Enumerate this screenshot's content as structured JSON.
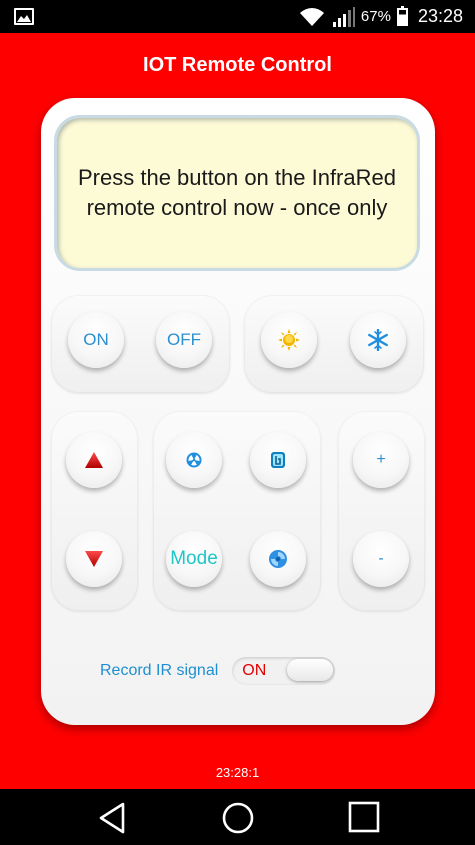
{
  "status_bar": {
    "battery_percent": "67%",
    "time": "23:28",
    "icons": [
      "image-icon",
      "wifi-icon",
      "signal-icon",
      "battery-icon"
    ]
  },
  "app_bar": {
    "title": "IOT Remote Control"
  },
  "display": {
    "message": "Press the button on the InfraRed remote control now - once only"
  },
  "power": {
    "on_label": "ON",
    "off_label": "OFF"
  },
  "mode_panel": {
    "heat_icon": "sun-icon",
    "cool_icon": "snowflake-icon"
  },
  "temp_panel": {
    "up_icon": "triangle-up-icon",
    "down_icon": "triangle-down-icon"
  },
  "function_panel": {
    "fan_icon": "fan-icon",
    "swing_icon": "swing-icon",
    "mode_label": "Mode",
    "turbo_icon": "swirl-icon"
  },
  "speed_panel": {
    "plus_label": "+",
    "minus_label": "-"
  },
  "record": {
    "label": "Record IR signal",
    "toggle_state": "ON"
  },
  "footer": {
    "time": "23:28:1"
  },
  "colors": {
    "background": "#ff0000",
    "accent_blue": "#2a8fd0",
    "mode_cyan": "#1fc7c7",
    "toggle_red": "#e60000"
  }
}
